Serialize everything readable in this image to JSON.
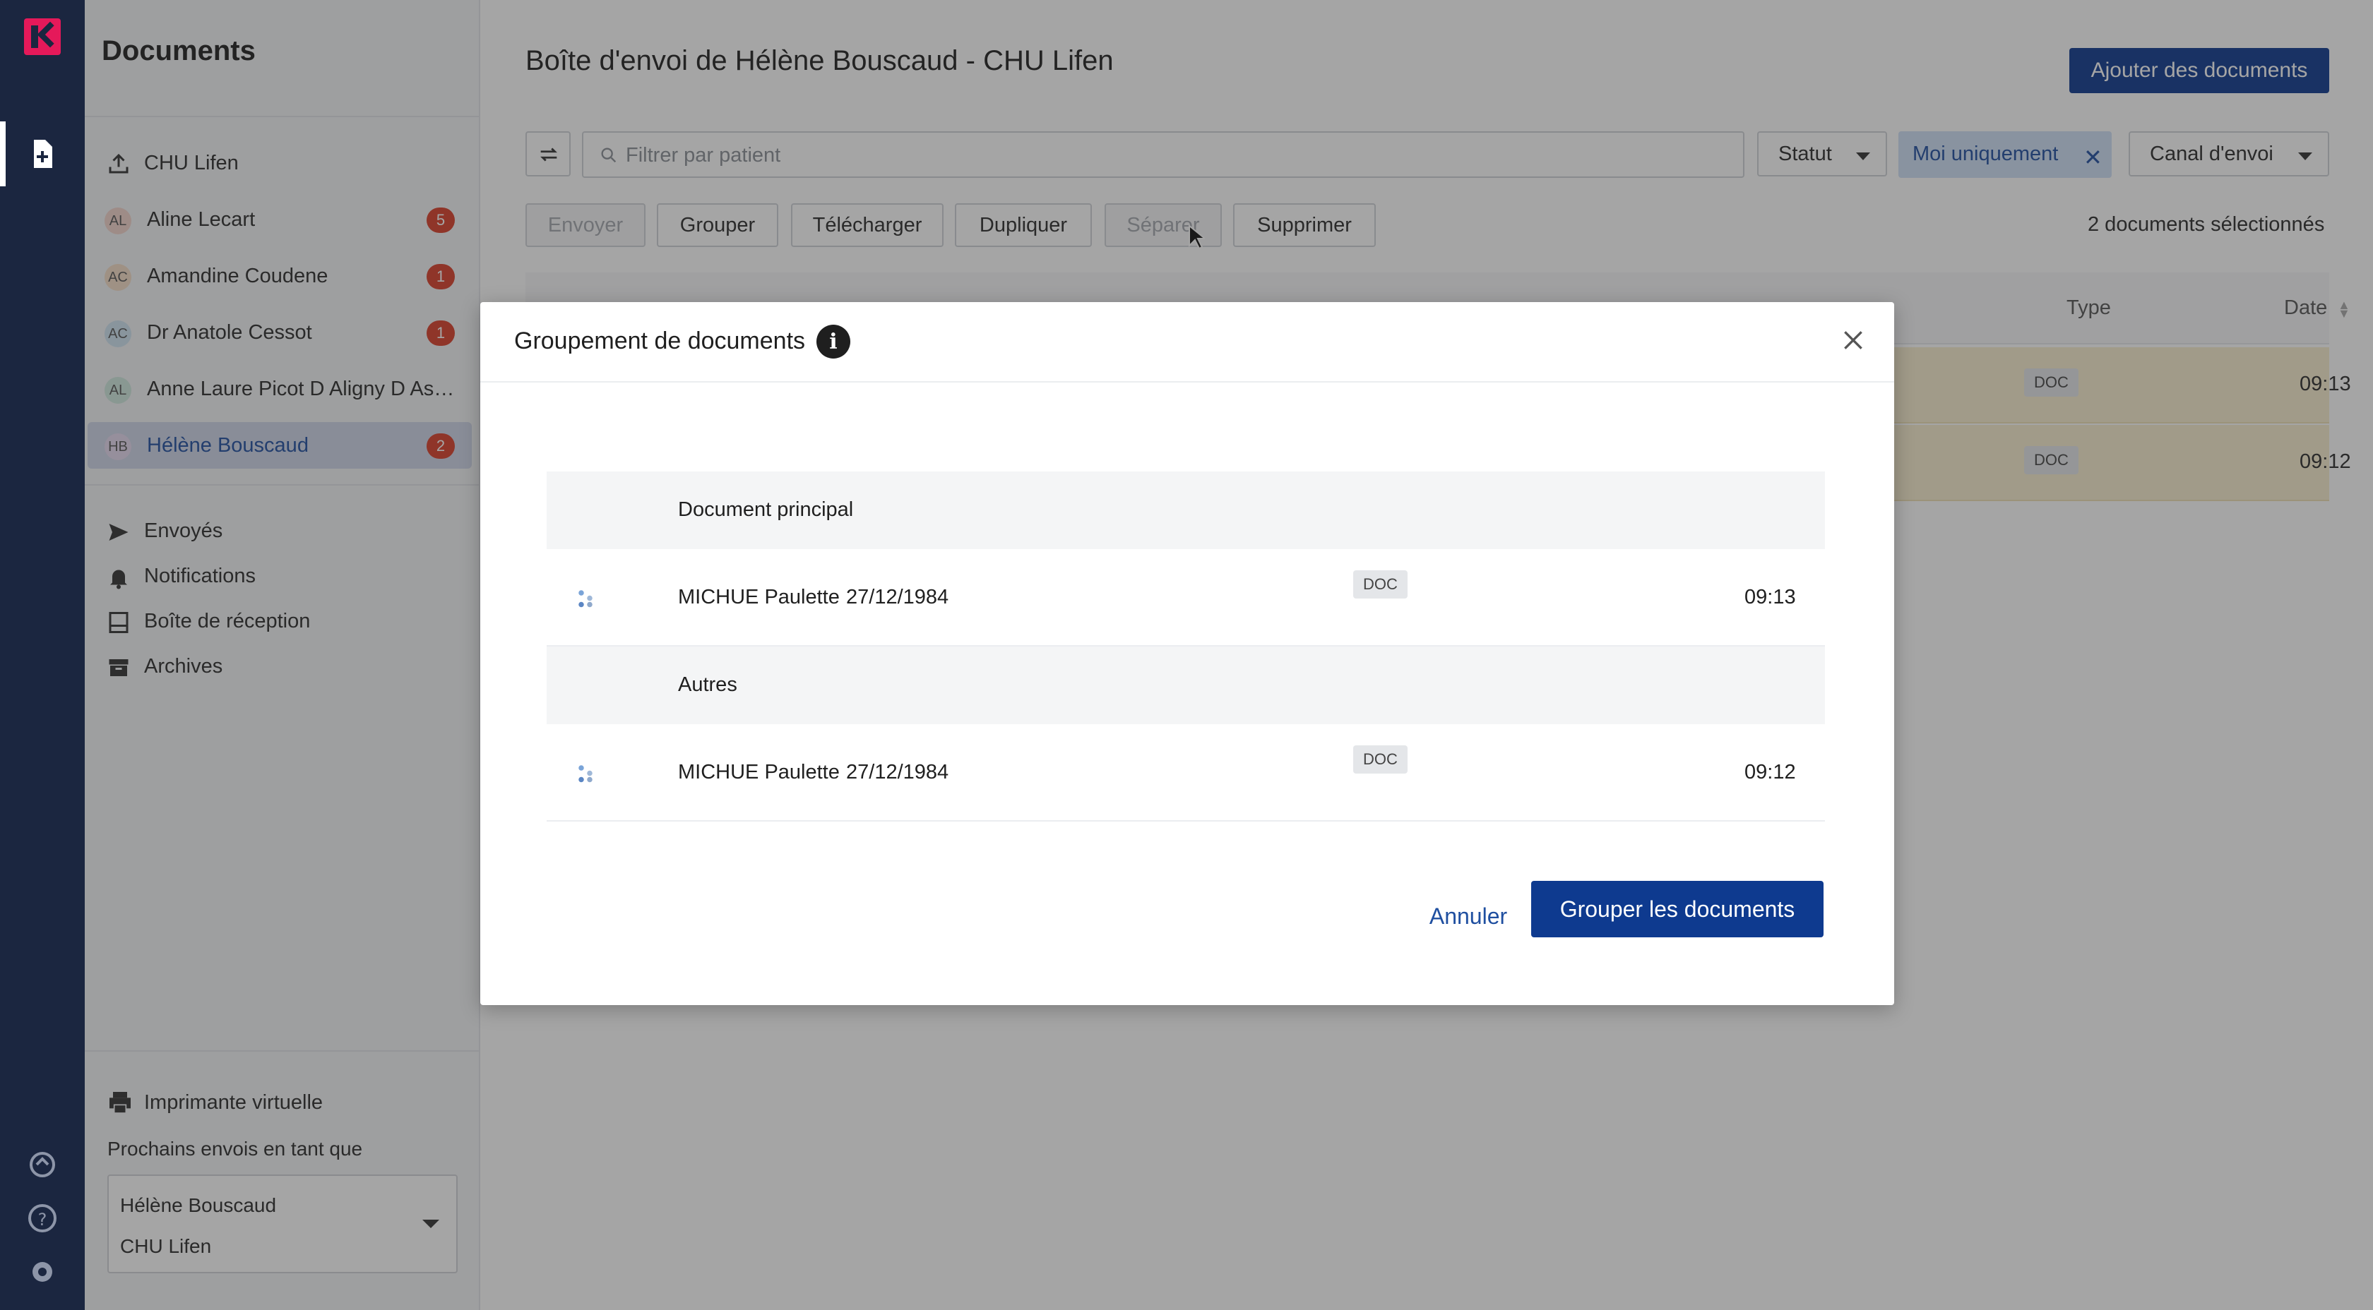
{
  "sidebar": {
    "title": "Documents",
    "org": "CHU Lifen",
    "users": [
      {
        "initials": "AL",
        "name": "Aline Lecart",
        "count": "5",
        "avatar_color": "#f3d4cc"
      },
      {
        "initials": "AC",
        "name": "Amandine Coudene",
        "count": "1",
        "avatar_color": "#f5dcc6"
      },
      {
        "initials": "AC",
        "name": "Dr Anatole Cessot",
        "count": "1",
        "avatar_color": "#cfe3f2"
      },
      {
        "initials": "AL",
        "name": "Anne Laure Picot D Aligny D Ass...",
        "count": "",
        "avatar_color": "#cfe8de"
      },
      {
        "initials": "HB",
        "name": "Hélène Bouscaud",
        "count": "2",
        "avatar_color": "#e6d9ef"
      }
    ],
    "nav": [
      {
        "label": "Envoyés",
        "icon": "send-icon"
      },
      {
        "label": "Notifications",
        "icon": "bell-icon"
      },
      {
        "label": "Boîte de réception",
        "icon": "inbox-icon"
      },
      {
        "label": "Archives",
        "icon": "archive-icon"
      }
    ],
    "printer_label": "Imprimante virtuelle",
    "send_as_label": "Prochains envois en tant que",
    "sender": {
      "name": "Hélène Bouscaud",
      "org": "CHU Lifen"
    }
  },
  "main": {
    "title": "Boîte d'envoi de Hélène Bouscaud - CHU Lifen",
    "add_button": "Ajouter des documents",
    "filter_placeholder": "Filtrer par patient",
    "status_dropdown": "Statut",
    "chip_label": "Moi uniquement",
    "channel_dropdown": "Canal d'envoi",
    "actions": [
      {
        "label": "Envoyer",
        "disabled": true
      },
      {
        "label": "Grouper",
        "disabled": false
      },
      {
        "label": "Télécharger",
        "disabled": false
      },
      {
        "label": "Dupliquer",
        "disabled": false
      },
      {
        "label": "Séparer",
        "disabled": true
      },
      {
        "label": "Supprimer",
        "disabled": false
      }
    ],
    "selected_count": "2 documents sélectionnés",
    "columns": {
      "type": "Type",
      "date": "Date"
    },
    "rows": [
      {
        "type": "DOC",
        "time": "09:13"
      },
      {
        "type": "DOC",
        "time": "09:12"
      }
    ]
  },
  "modal": {
    "title": "Groupement de documents",
    "main_section": "Document principal",
    "other_section": "Autres",
    "documents": [
      {
        "name": "MICHUE Paulette",
        "dob": "27/12/1984",
        "type": "DOC",
        "time": "09:13"
      },
      {
        "name": "MICHUE Paulette",
        "dob": "27/12/1984",
        "type": "DOC",
        "time": "09:12"
      }
    ],
    "cancel_label": "Annuler",
    "confirm_label": "Grouper les documents"
  },
  "colors": {
    "accent": "#0e3a8f",
    "rail": "#1b2640",
    "badge": "#d93f2a",
    "highlight_row": "#f8eecf"
  }
}
